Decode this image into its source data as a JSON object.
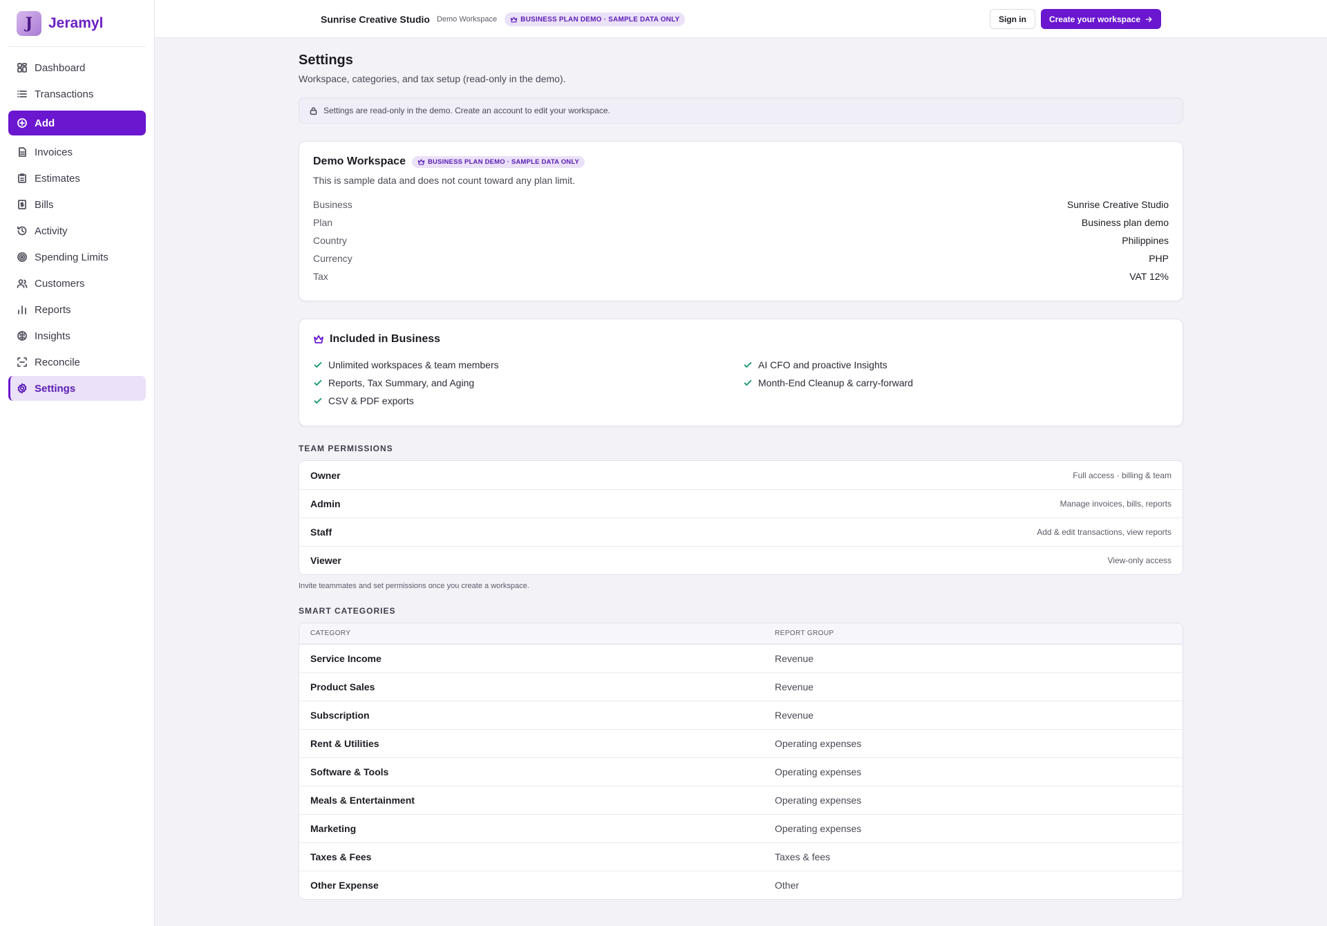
{
  "brand": {
    "logo_letter": "J",
    "name": "Jeramyl",
    "accent": "#6a17cf"
  },
  "sidebar": {
    "items": [
      {
        "label": "Dashboard",
        "icon": "grid-icon"
      },
      {
        "label": "Transactions",
        "icon": "list-icon"
      },
      {
        "label": "Add",
        "icon": "plus-circle-icon"
      },
      {
        "label": "Invoices",
        "icon": "document-icon"
      },
      {
        "label": "Estimates",
        "icon": "clipboard-icon"
      },
      {
        "label": "Bills",
        "icon": "dollar-receipt-icon"
      },
      {
        "label": "Activity",
        "icon": "history-icon"
      },
      {
        "label": "Spending Limits",
        "icon": "target-icon"
      },
      {
        "label": "Customers",
        "icon": "users-icon"
      },
      {
        "label": "Reports",
        "icon": "bar-chart-icon"
      },
      {
        "label": "Insights",
        "icon": "brain-icon"
      },
      {
        "label": "Reconcile",
        "icon": "scan-icon"
      },
      {
        "label": "Settings",
        "icon": "gear-icon"
      }
    ],
    "active": "Settings"
  },
  "topbar": {
    "business_name": "Sunrise Creative Studio",
    "workspace_label": "Demo Workspace",
    "badge": "BUSINESS PLAN DEMO · SAMPLE DATA ONLY",
    "sign_in": "Sign in",
    "create": "Create your workspace"
  },
  "page": {
    "title": "Settings",
    "subtitle": "Workspace, categories, and tax setup (read-only in the demo).",
    "notice": "Settings are read-only in the demo. Create an account to edit your workspace."
  },
  "workspace": {
    "title": "Demo Workspace",
    "badge": "BUSINESS PLAN DEMO · SAMPLE DATA ONLY",
    "description": "This is sample data and does not count toward any plan limit.",
    "fields": [
      {
        "key": "Business",
        "value": "Sunrise Creative Studio"
      },
      {
        "key": "Plan",
        "value": "Business plan demo"
      },
      {
        "key": "Country",
        "value": "Philippines"
      },
      {
        "key": "Currency",
        "value": "PHP"
      },
      {
        "key": "Tax",
        "value": "VAT 12%"
      }
    ]
  },
  "included": {
    "title": "Included in Business",
    "features": [
      "Unlimited workspaces & team members",
      "AI CFO and proactive Insights",
      "Reports, Tax Summary, and Aging",
      "Month-End Cleanup & carry-forward",
      "CSV & PDF exports"
    ]
  },
  "team_permissions": {
    "label": "TEAM PERMISSIONS",
    "roles": [
      {
        "role": "Owner",
        "desc": "Full access · billing & team"
      },
      {
        "role": "Admin",
        "desc": "Manage invoices, bills, reports"
      },
      {
        "role": "Staff",
        "desc": "Add & edit transactions, view reports"
      },
      {
        "role": "Viewer",
        "desc": "View-only access"
      }
    ],
    "hint": "Invite teammates and set permissions once you create a workspace."
  },
  "smart_categories": {
    "label": "SMART CATEGORIES",
    "columns": [
      "CATEGORY",
      "REPORT GROUP"
    ],
    "rows": [
      [
        "Service Income",
        "Revenue"
      ],
      [
        "Product Sales",
        "Revenue"
      ],
      [
        "Subscription",
        "Revenue"
      ],
      [
        "Rent & Utilities",
        "Operating expenses"
      ],
      [
        "Software & Tools",
        "Operating expenses"
      ],
      [
        "Meals & Entertainment",
        "Operating expenses"
      ],
      [
        "Marketing",
        "Operating expenses"
      ],
      [
        "Taxes & Fees",
        "Taxes & fees"
      ],
      [
        "Other Expense",
        "Other"
      ]
    ]
  }
}
